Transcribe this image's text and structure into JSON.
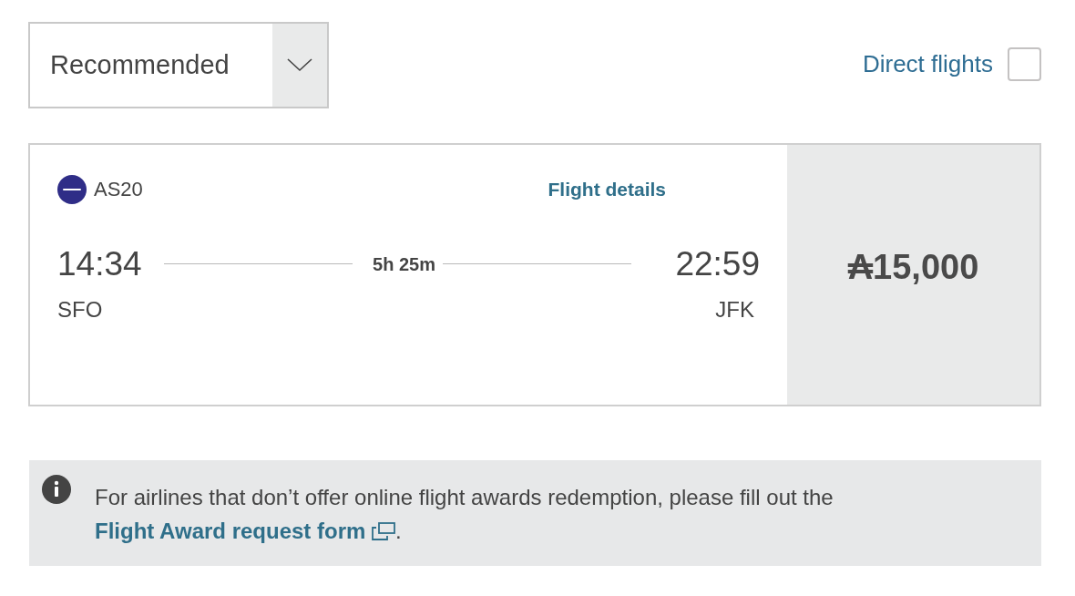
{
  "sort": {
    "value": "Recommended"
  },
  "filter": {
    "label": "Direct flights",
    "checked": false
  },
  "flight": {
    "number": "AS20",
    "details_link": "Flight details",
    "depart_time": "14:34",
    "depart_airport": "SFO",
    "duration": "5h 25m",
    "arrive_time": "22:59",
    "arrive_airport": "JFK",
    "price": "₳15,000"
  },
  "notice": {
    "text": "For airlines that don’t offer online flight awards redemption, please fill out the ",
    "link": "Flight Award request form",
    "after": "."
  }
}
